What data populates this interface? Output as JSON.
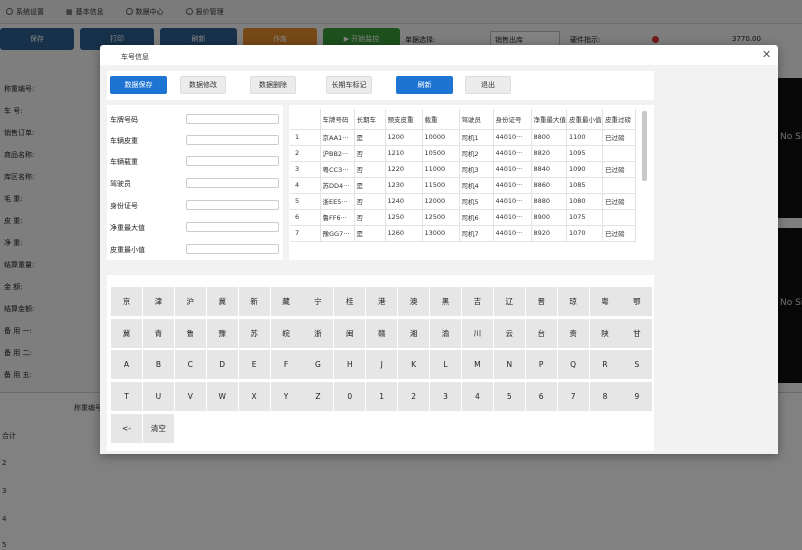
{
  "background": {
    "menu": [
      {
        "label": "系统设置",
        "icon": "radio-icon"
      },
      {
        "label": "基本信息",
        "icon": "grid-icon"
      },
      {
        "label": "数据中心",
        "icon": "chart-icon"
      },
      {
        "label": "报价管理",
        "icon": "radio-icon"
      }
    ],
    "toolbar": {
      "save": "保存",
      "print": "打印",
      "refresh": "刷新",
      "void": "作废",
      "monitor": "▶ 开始监控",
      "mode_label": "单据选择:",
      "mode_value": "销售出库",
      "hardware_label": "硬件指示:",
      "weight_value": "3770.00"
    },
    "form_labels": [
      "称重编号:",
      "车 号:",
      "销售订单:",
      "商品名称:",
      "库区名称:",
      "毛 重:",
      "皮 重:",
      "净 重:",
      "结算重量:",
      "金 额:",
      "结算金额:",
      "备 用 一:",
      "备 用 二:",
      "备 用 五:"
    ],
    "table_head": "称重编号",
    "table_rows": [
      "合计",
      "2",
      "3",
      "4",
      "5"
    ],
    "video_text": "No Sig"
  },
  "modal": {
    "title": "车号信息",
    "actions": {
      "save": "数据保存",
      "edit": "数据修改",
      "delete": "数据删除",
      "long_term": "长期车标记",
      "refresh": "刷新",
      "exit": "退出"
    },
    "form": {
      "plate": "车牌号码",
      "tare": "车辆皮重",
      "load": "车辆载重",
      "driver": "驾驶员",
      "id_no": "身份证号",
      "net_max": "净重最大值",
      "tare_min": "皮重最小值"
    },
    "table": {
      "columns": [
        "",
        "车牌号码",
        "长期车",
        "预支皮重",
        "载重",
        "驾驶员",
        "身份证号",
        "净重最大值",
        "皮重最小值",
        "皮重过磅"
      ],
      "rows": [
        [
          "1",
          "京AA1···",
          "是",
          "1200",
          "10000",
          "司机1",
          "44010···",
          "8800",
          "1100",
          "已过磅"
        ],
        [
          "2",
          "沪BB2···",
          "否",
          "1210",
          "10500",
          "司机2",
          "44010···",
          "8820",
          "1095",
          ""
        ],
        [
          "3",
          "粤CC3···",
          "否",
          "1220",
          "11000",
          "司机3",
          "44010···",
          "8840",
          "1090",
          "已过磅"
        ],
        [
          "4",
          "苏DD4···",
          "是",
          "1230",
          "11500",
          "司机4",
          "44010···",
          "8860",
          "1085",
          ""
        ],
        [
          "5",
          "浙EE5···",
          "否",
          "1240",
          "12000",
          "司机5",
          "44010···",
          "8880",
          "1080",
          "已过磅"
        ],
        [
          "6",
          "鲁FF6···",
          "否",
          "1250",
          "12500",
          "司机6",
          "44010···",
          "8900",
          "1075",
          ""
        ],
        [
          "7",
          "豫GG7···",
          "是",
          "1260",
          "13000",
          "司机7",
          "44010···",
          "8920",
          "1070",
          "已过磅"
        ]
      ]
    },
    "keyboard": [
      [
        "京",
        "津",
        "沪",
        "冀",
        "新",
        "藏",
        "宁",
        "桂",
        "港",
        "澳",
        "黑",
        "吉",
        "辽",
        "晋",
        "琼",
        "粤",
        "鄂"
      ],
      [
        "冀",
        "青",
        "鲁",
        "豫",
        "苏",
        "皖",
        "浙",
        "闽",
        "赣",
        "湘",
        "渝",
        "川",
        "云",
        "台",
        "贵",
        "陕",
        "甘"
      ],
      [
        "A",
        "B",
        "C",
        "D",
        "E",
        "F",
        "G",
        "H",
        "J",
        "K",
        "L",
        "M",
        "N",
        "P",
        "Q",
        "R",
        "S"
      ],
      [
        "T",
        "U",
        "V",
        "W",
        "X",
        "Y",
        "Z",
        "0",
        "1",
        "2",
        "3",
        "4",
        "5",
        "6",
        "7",
        "8",
        "9"
      ],
      [
        "<-",
        "清空"
      ]
    ]
  },
  "colors": {
    "primary": "#1e74d2",
    "toolbar_blue": "#2d5f8f",
    "toolbar_orange": "#e38a2b",
    "toolbar_green": "#3b9a3b"
  }
}
